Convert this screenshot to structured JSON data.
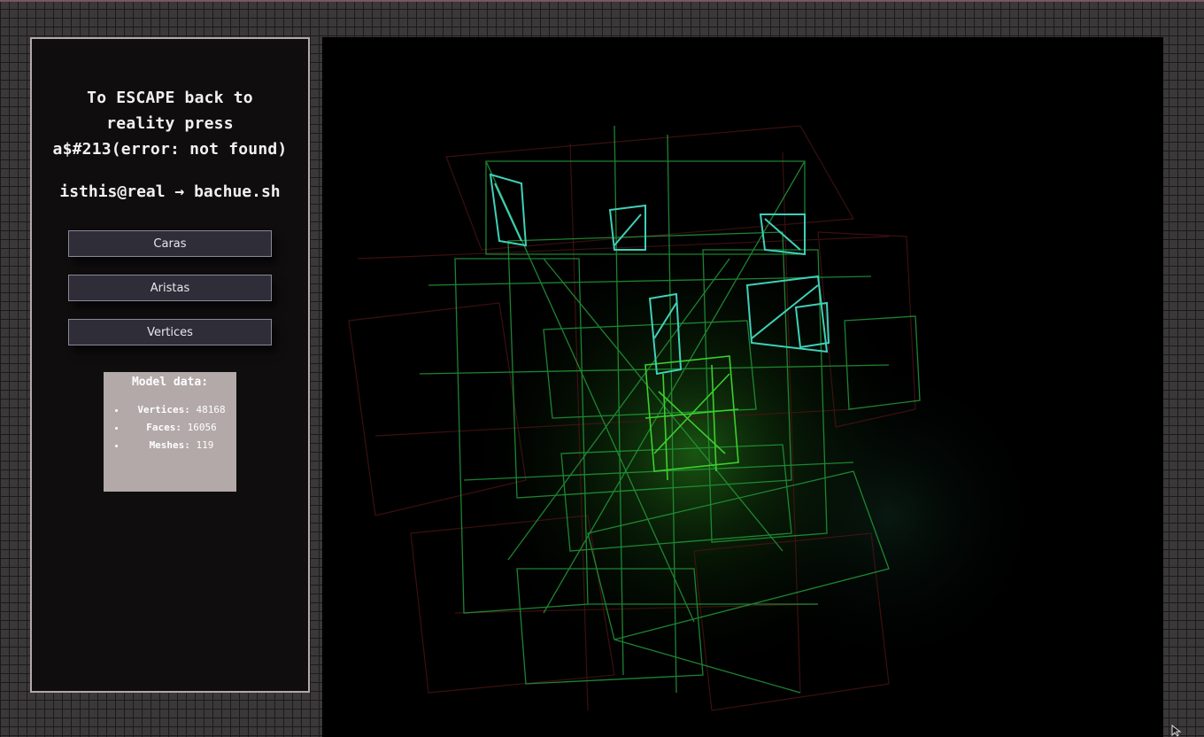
{
  "sidebar": {
    "escape_lines": [
      "To ESCAPE back to",
      "reality press",
      "a$#213(error: not found)"
    ],
    "path": "isthis@real → bachue.sh",
    "buttons": [
      "Caras",
      "Aristas",
      "Vertices"
    ],
    "model": {
      "title": "Model data:",
      "stats": [
        {
          "label": "Vertices:",
          "value": "48168"
        },
        {
          "label": "Faces:",
          "value": "16056"
        },
        {
          "label": "Meshes:",
          "value": "119"
        }
      ]
    }
  },
  "viewport": {
    "mode": "wireframe",
    "colors": {
      "wire": "#2fae3a",
      "highlight": "#3fd0b8",
      "glow": "#3fbf2a",
      "dim": "#5a1a1a"
    }
  }
}
